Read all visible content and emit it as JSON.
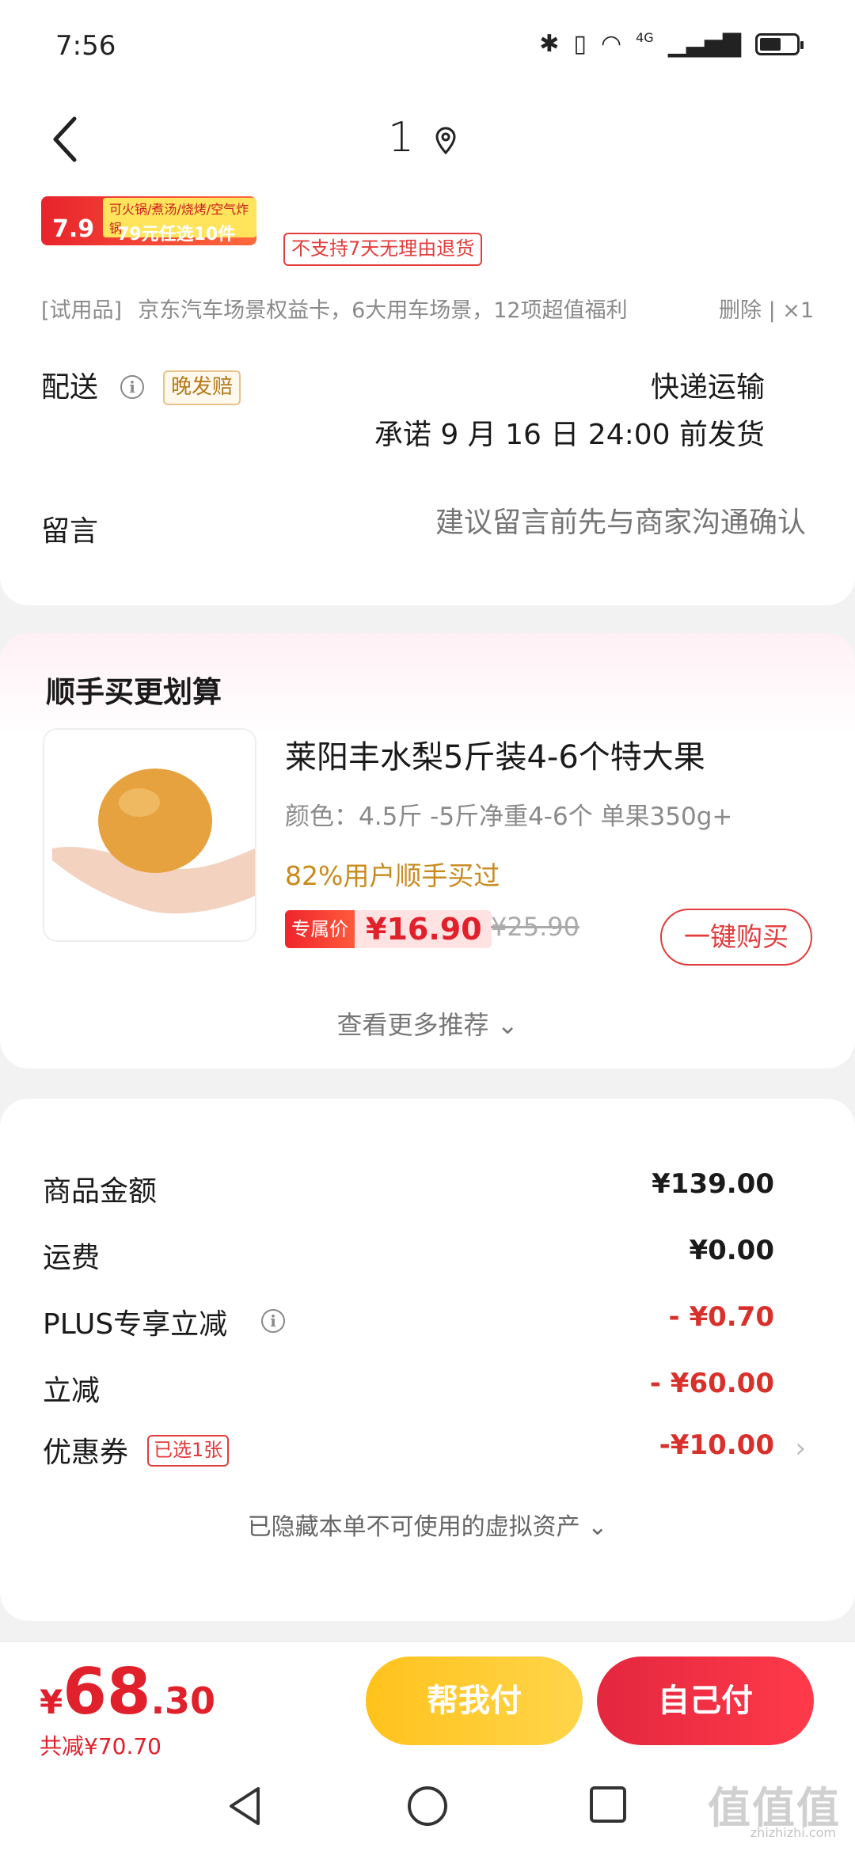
{
  "status": {
    "time": "7:56",
    "network": "4G"
  },
  "nav": {
    "title": "1"
  },
  "item": {
    "promo_price": "7.9",
    "promo_top": "可火锅/煮汤/烧烤/空气炸锅",
    "promo_bottom": "79元任选10件",
    "no_return_tag": "不支持7天无理由退货",
    "trial_tag": "[试用品]",
    "trial_text": "京东汽车场景权益卡，6大用车场景，12项超值福利",
    "trial_action": "删除 | ×1"
  },
  "shipping": {
    "label": "配送",
    "late_tag": "晚发赔",
    "method": "快递运输",
    "promise": "承诺 9 月 16 日 24:00 前发货"
  },
  "message": {
    "label": "留言",
    "placeholder": "建议留言前先与商家沟通确认"
  },
  "recommend": {
    "title": "顺手买更划算",
    "product": {
      "name": "莱阳丰水梨5斤装4-6个特大果",
      "spec": "颜色：4.5斤 -5斤净重4-6个 单果350g+",
      "social": "82%用户顺手买过",
      "price_tag": "专属价",
      "price": "¥16.90",
      "original_price": "¥25.90",
      "buy_label": "一键购买"
    },
    "more_label": "查看更多推荐"
  },
  "summary": {
    "rows": [
      {
        "label": "商品金额",
        "value": "¥139.00"
      },
      {
        "label": "运费",
        "value": "¥0.00"
      },
      {
        "label": "PLUS专享立减",
        "value": "- ¥0.70"
      },
      {
        "label": "立减",
        "value": "- ¥60.00"
      },
      {
        "label": "优惠券",
        "value": "-¥10.00",
        "tag": "已选1张"
      }
    ],
    "hidden_hint": "已隐藏本单不可使用的虚拟资产"
  },
  "footer": {
    "currency": "¥",
    "total_int": "68",
    "total_dec": ".30",
    "saved": "共减¥70.70",
    "help_pay": "帮我付",
    "self_pay": "自己付"
  },
  "colors": {
    "accent_red": "#e0202a",
    "help_yellow": "#ffc21c",
    "late_tag_gold": "#b47a1a"
  }
}
